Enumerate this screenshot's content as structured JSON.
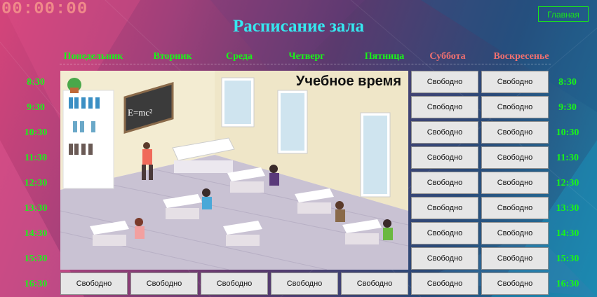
{
  "timer": "00:00:00",
  "title": "Расписание зала",
  "home_button": "Главная",
  "days": [
    {
      "label": "Понедельник",
      "color": "#19f519"
    },
    {
      "label": "Вторник",
      "color": "#19f519"
    },
    {
      "label": "Среда",
      "color": "#19f519"
    },
    {
      "label": "Четверг",
      "color": "#19f519"
    },
    {
      "label": "Пятница",
      "color": "#19f519"
    },
    {
      "label": "Суббота",
      "color": "#f07070"
    },
    {
      "label": "Воскресенье",
      "color": "#f07070"
    }
  ],
  "times": [
    "8:30",
    "9:30",
    "10:30",
    "11:30",
    "12:30",
    "13:30",
    "14:30",
    "15:30",
    "16:30"
  ],
  "slot_label": "Свободно",
  "classroom": {
    "label": "Учебное время",
    "formula": "E=mc²"
  },
  "colors": {
    "title": "#35e8f0",
    "time": "#19f519",
    "weekend": "#f07070",
    "timer": "#f08a8a"
  }
}
